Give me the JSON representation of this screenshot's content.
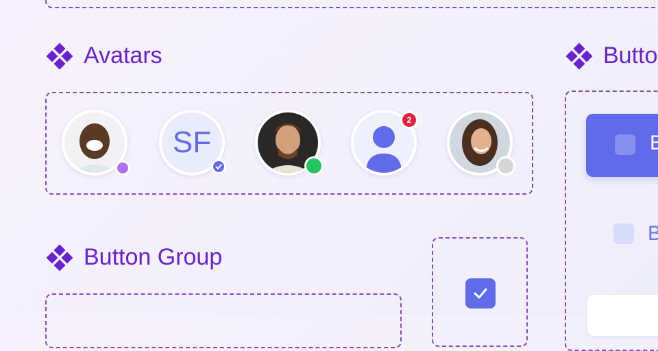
{
  "sections": {
    "avatars_title": "Avatars",
    "button_group_title": "Button Group",
    "buttons_title": "Butto"
  },
  "avatars": [
    {
      "name": "avatar-1",
      "status": "purple-badge"
    },
    {
      "name": "avatar-2",
      "initials": "SF",
      "status": "verified"
    },
    {
      "name": "avatar-3",
      "status": "online"
    },
    {
      "name": "avatar-4",
      "badge_count": "2"
    },
    {
      "name": "avatar-5",
      "status": "offline"
    }
  ],
  "buttons": {
    "primary_label": "B",
    "secondary_label": "B"
  },
  "colors": {
    "purple": "#6a22cf",
    "dash": "#8a46c4",
    "primary": "#5f6be8",
    "online": "#22c55e",
    "offline": "#d6d6d6",
    "badge": "#e1223a"
  }
}
